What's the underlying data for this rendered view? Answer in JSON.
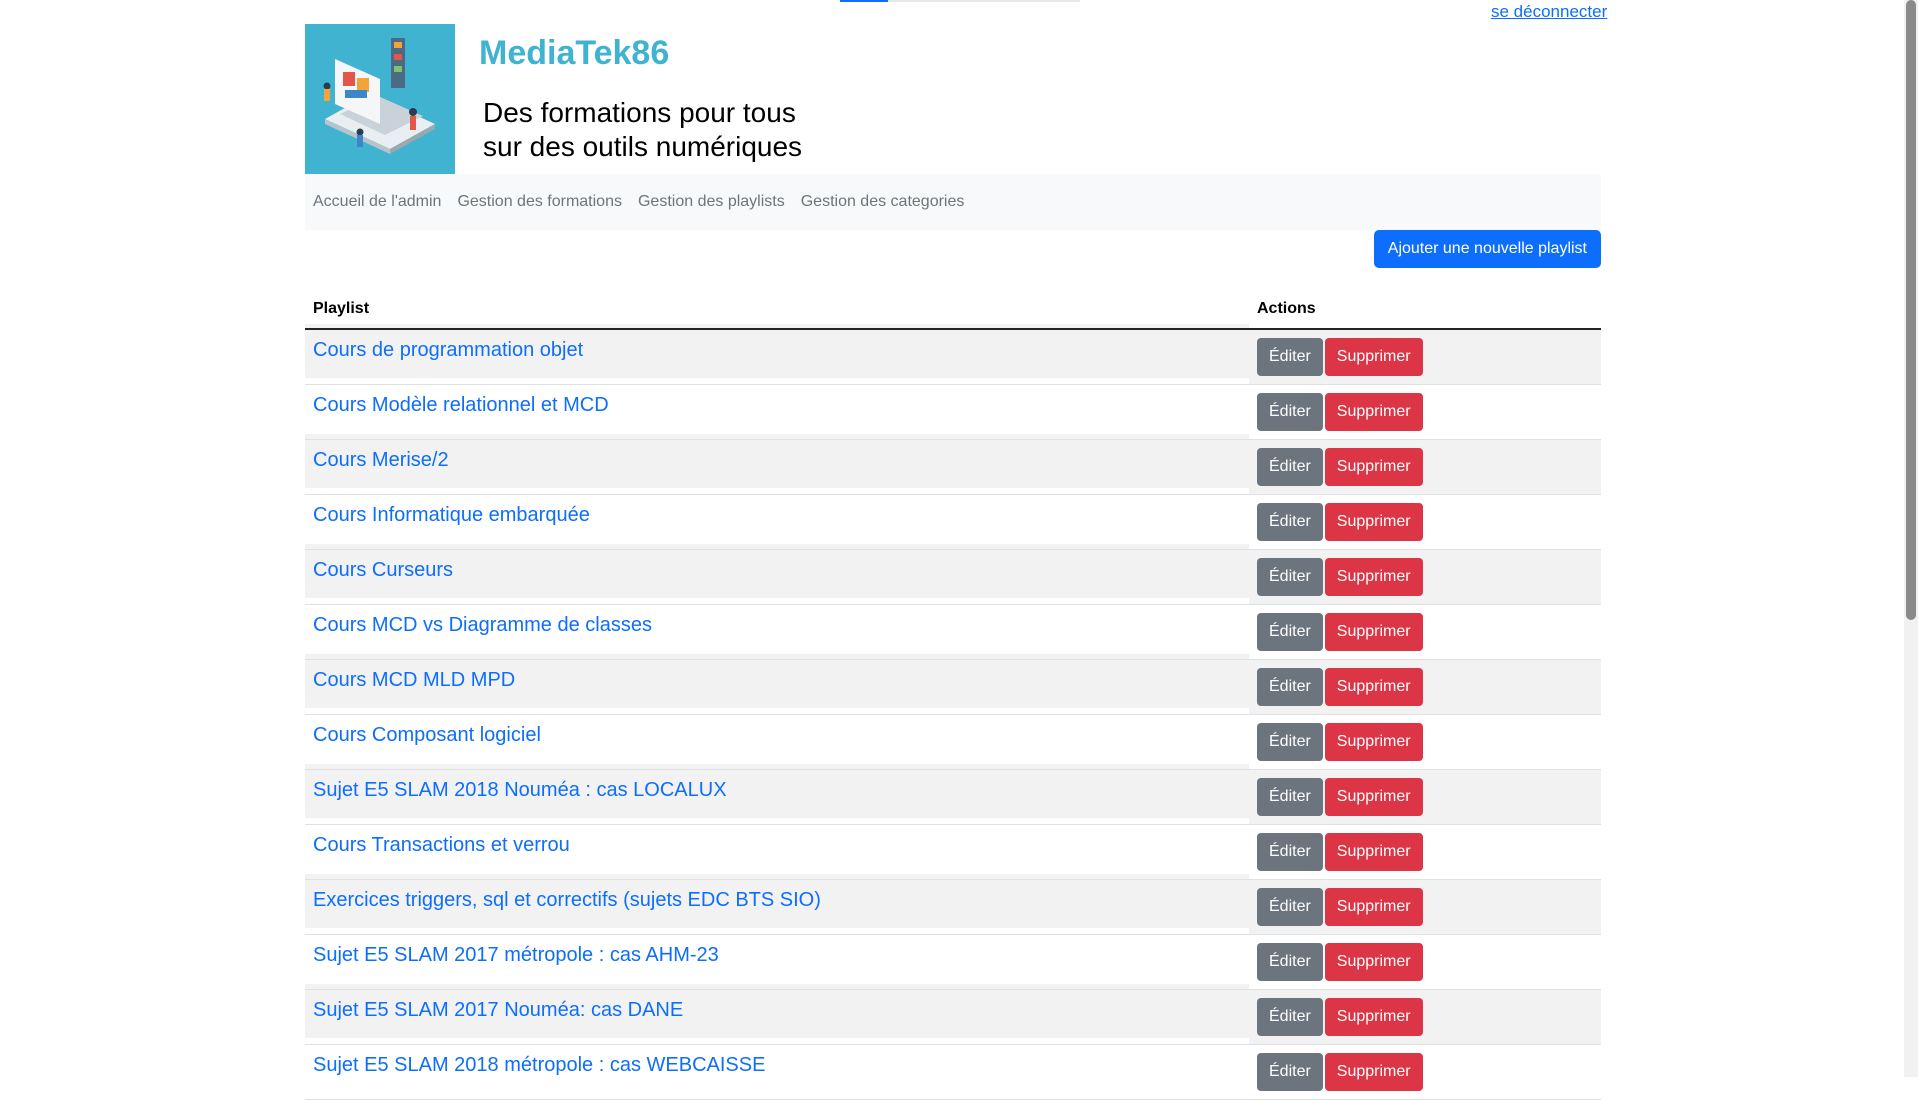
{
  "header": {
    "logout": "se déconnecter",
    "brand": "MediaTek86",
    "tagline": "Des formations pour tous\nsur des outils numériques"
  },
  "nav": [
    {
      "label": "Accueil de l'admin"
    },
    {
      "label": "Gestion des formations"
    },
    {
      "label": "Gestion des playlists"
    },
    {
      "label": "Gestion des categories"
    }
  ],
  "add_button": "Ajouter une nouvelle playlist",
  "table": {
    "headers": [
      "Playlist",
      "Actions"
    ],
    "edit_label": "Éditer",
    "delete_label": "Supprimer",
    "rows": [
      "Cours de programmation objet",
      "Cours Modèle relationnel et MCD",
      "Cours Merise/2",
      "Cours Informatique embarquée",
      "Cours Curseurs",
      "Cours MCD vs Diagramme de classes",
      "Cours MCD MLD MPD",
      "Cours Composant logiciel",
      "Sujet E5 SLAM 2018 Nouméa : cas LOCALUX",
      "Cours Transactions et verrou",
      "Exercices triggers, sql et correctifs (sujets EDC BTS SIO)",
      "Sujet E5 SLAM 2017 métropole : cas AHM-23",
      "Sujet E5 SLAM 2017 Nouméa: cas DANE",
      "Sujet E5 SLAM 2018 métropole : cas WEBCAISSE"
    ]
  },
  "colors": {
    "primary": "#0d6efd",
    "secondary": "#6c757d",
    "danger": "#dc3545",
    "brand": "#3fb3cf"
  }
}
